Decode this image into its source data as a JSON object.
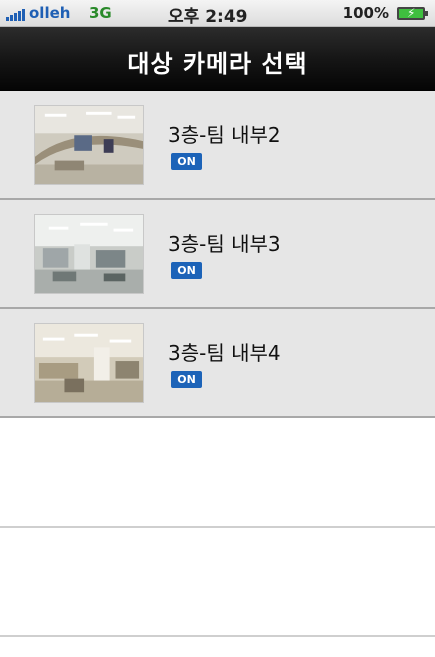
{
  "status_bar": {
    "carrier": "olleh",
    "network": "3G",
    "time": "오후 2:49",
    "battery": "100%",
    "icons": [
      "signal-icon",
      "battery-charging-icon"
    ]
  },
  "nav": {
    "title": "대상 카메라 선택"
  },
  "cameras": [
    {
      "name": "3층-팀 내부2",
      "status": "ON"
    },
    {
      "name": "3층-팀 내부3",
      "status": "ON"
    },
    {
      "name": "3층-팀 내부4",
      "status": "ON"
    }
  ],
  "colors": {
    "accent": "#1c63b8",
    "row_background": "#e6e6e6",
    "nav_background": "#111111"
  }
}
